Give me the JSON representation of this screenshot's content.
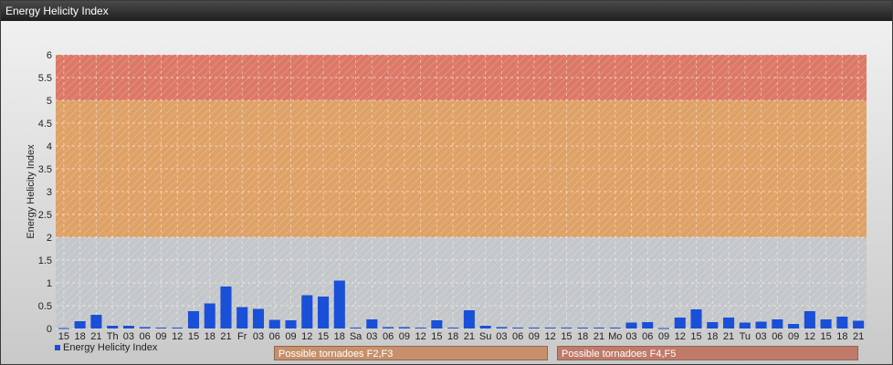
{
  "window": {
    "title": "Energy Helicity Index"
  },
  "chart_data": {
    "type": "bar",
    "ylabel": "Energy Helicity Index",
    "ylim": [
      0,
      6
    ],
    "yticks": [
      "0",
      "0.5",
      "1",
      "1.5",
      "2",
      "2.5",
      "3",
      "3.5",
      "4",
      "4.5",
      "5",
      "5.5",
      "6"
    ],
    "grid": true,
    "categories": [
      "15",
      "18",
      "21",
      "Th",
      "03",
      "06",
      "09",
      "12",
      "15",
      "18",
      "21",
      "Fr",
      "03",
      "06",
      "09",
      "12",
      "15",
      "18",
      "Sa",
      "03",
      "06",
      "09",
      "12",
      "15",
      "18",
      "21",
      "Su",
      "03",
      "06",
      "09",
      "12",
      "15",
      "18",
      "21",
      "Mo",
      "03",
      "06",
      "09",
      "12",
      "15",
      "18",
      "21",
      "Tu",
      "03",
      "06",
      "09",
      "12",
      "15",
      "18",
      "21"
    ],
    "series": [
      {
        "name": "Energy Helicity Index",
        "color": "#1a4fd8",
        "values": [
          0.01,
          0.16,
          0.3,
          0.06,
          0.06,
          0.03,
          0.02,
          0.02,
          0.38,
          0.55,
          0.92,
          0.47,
          0.43,
          0.19,
          0.18,
          0.73,
          0.7,
          1.05,
          0.02,
          0.2,
          0.03,
          0.03,
          0.02,
          0.18,
          0.02,
          0.4,
          0.06,
          0.03,
          0.02,
          0.02,
          0.02,
          0.02,
          0.02,
          0.02,
          0.02,
          0.13,
          0.14,
          0.01,
          0.24,
          0.42,
          0.14,
          0.24,
          0.13,
          0.15,
          0.2,
          0.1,
          0.38,
          0.2,
          0.26,
          0.17
        ]
      }
    ],
    "bands": [
      {
        "from": 2,
        "to": 5,
        "label": "Possible tornadoes F2,F3",
        "color": "#e39a55"
      },
      {
        "from": 5,
        "to": 6,
        "label": "Possible tornadoes F4,F5",
        "color": "#e06a55"
      }
    ]
  }
}
